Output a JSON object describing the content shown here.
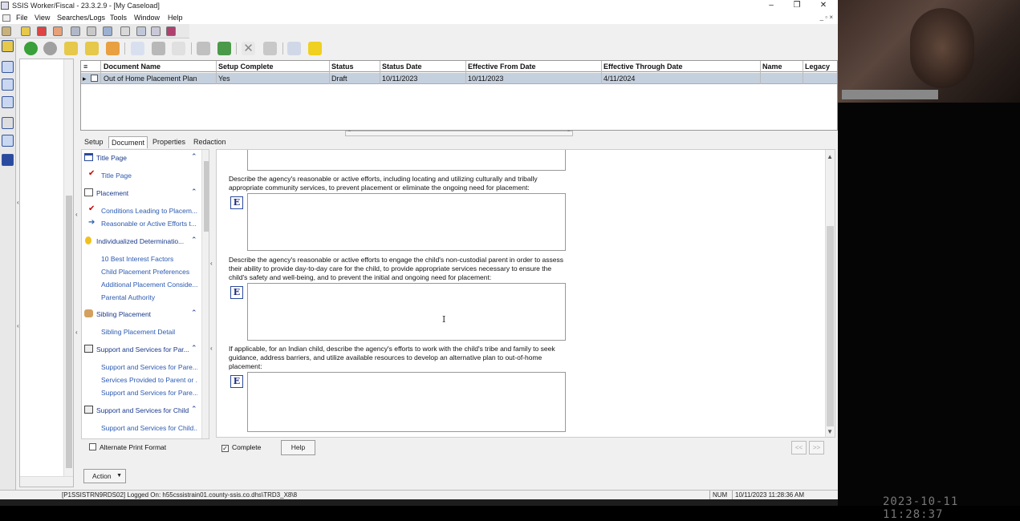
{
  "window": {
    "title": "SSIS Worker/Fiscal - 23.3.2.9 - [My Caseload]",
    "minimize": "–",
    "maximize": "❐",
    "close": "✕"
  },
  "menu": {
    "items": [
      "File",
      "View",
      "Searches/Logs",
      "Tools",
      "Window",
      "Help"
    ],
    "mdi_controls": "_ ▫ ×"
  },
  "grid": {
    "columns": [
      "Document Name",
      "Setup Complete",
      "Status",
      "Status Date",
      "Effective From Date",
      "Effective Through Date",
      "Name",
      "Legacy"
    ],
    "row_marker": "▸",
    "rows": [
      {
        "document_name": "Out of Home Placement Plan",
        "setup_complete": "Yes",
        "status": "Draft",
        "status_date": "10/11/2023",
        "effective_from": "10/11/2023",
        "effective_through": "4/11/2024",
        "name": "",
        "legacy": ""
      }
    ]
  },
  "tabs": [
    "Setup",
    "Document",
    "Properties",
    "Redaction"
  ],
  "nav": {
    "sections": [
      {
        "label": "Title Page",
        "items": [
          {
            "label": "Title Page",
            "mark": "check"
          }
        ]
      },
      {
        "label": "Placement",
        "items": [
          {
            "label": "Conditions Leading to Placem...",
            "mark": "check"
          },
          {
            "label": "Reasonable or Active Efforts t...",
            "mark": "arrow"
          }
        ]
      },
      {
        "label": "Individualized Determinatio...",
        "items": [
          {
            "label": "10 Best Interest Factors",
            "mark": ""
          },
          {
            "label": "Child Placement Preferences",
            "mark": ""
          },
          {
            "label": "Additional Placement Conside...",
            "mark": ""
          },
          {
            "label": "Parental Authority",
            "mark": ""
          }
        ]
      },
      {
        "label": "Sibling Placement",
        "items": [
          {
            "label": "Sibling Placement Detail",
            "mark": ""
          }
        ]
      },
      {
        "label": "Support and Services for Par...",
        "items": [
          {
            "label": "Support and Services for Pare...",
            "mark": ""
          },
          {
            "label": "Services Provided to Parent or ...",
            "mark": ""
          },
          {
            "label": "Support and Services for Pare...",
            "mark": ""
          }
        ]
      },
      {
        "label": "Support and Services for Child",
        "items": [
          {
            "label": "Support and Services for Child...",
            "mark": ""
          }
        ]
      }
    ],
    "chevron": "⌃",
    "alternate_print_format": "Alternate Print Format"
  },
  "content": {
    "e_label": "E",
    "questions": [
      "Describe the agency's reasonable or active efforts, including locating and utilizing culturally and tribally appropriate community services, to prevent placement or eliminate the ongoing need for placement:",
      "Describe the agency's reasonable or active efforts to engage the child's non-custodial parent in order to assess their ability to provide day-to-day care for the child, to provide appropriate services necessary to ensure the child's safety and well-being, and to prevent the initial and ongoing need for placement:",
      "If applicable, for an Indian child, describe the agency's efforts to work with the child's tribe and family to seek guidance, address barriers, and utilize available resources to develop an alternative plan to out-of-home placement:"
    ],
    "cursor": "I"
  },
  "footer": {
    "complete_label": "Complete",
    "complete_checked": true,
    "help_label": "Help",
    "prev_label": "<<",
    "next_label": ">>",
    "action_label": "Action"
  },
  "statusbar": {
    "server": "[P1SSISTRN9RDS02] Logged On: h55cssistrain01.county-ssis.co.dhs\\TRD3_X8\\8",
    "num": "NUM",
    "datetime": "10/11/2023 11:28:36 AM"
  },
  "video": {
    "timestamp": "2023-10-11 11:28:37"
  }
}
